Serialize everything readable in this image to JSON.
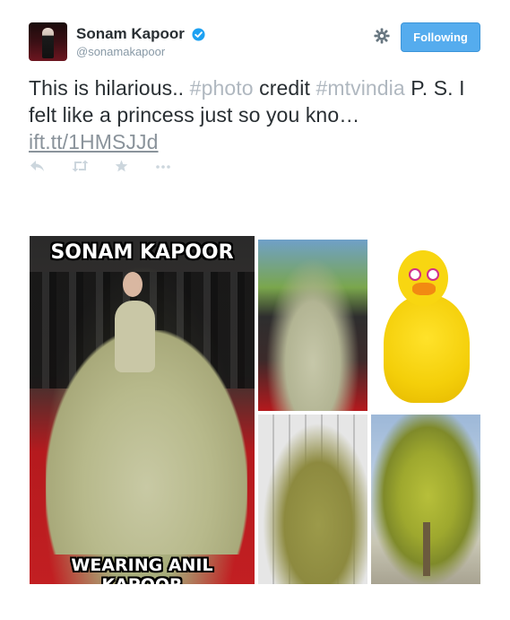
{
  "user": {
    "full_name": "Sonam Kapoor",
    "screen_name": "@sonamakapoor",
    "verified": true
  },
  "follow_button": {
    "label": "Following"
  },
  "tweet": {
    "text_part1": "This is hilarious.. ",
    "hashtag1": "#photo",
    "text_part2": " credit  ",
    "hashtag2": "#mtvindia",
    "text_part3": "  P. S. I felt like a princess just so you kno… ",
    "link": "ift.tt/1HMSJJd"
  },
  "actions": {
    "icons": [
      "reply-icon",
      "retweet-icon",
      "favorite-icon",
      "more-icon"
    ]
  },
  "media": {
    "meme_top_text": "SONAM KAPOOR",
    "meme_bottom_text": "WEARING ANIL KAPOOR"
  },
  "colors": {
    "accent": "#55acee",
    "verified": "#1da1f2",
    "hashtag": "#b0b8c0",
    "action_icon": "#ccd6dd",
    "meme_red_carpet": "#c21f22",
    "big_bird_yellow": "#f8d611"
  }
}
